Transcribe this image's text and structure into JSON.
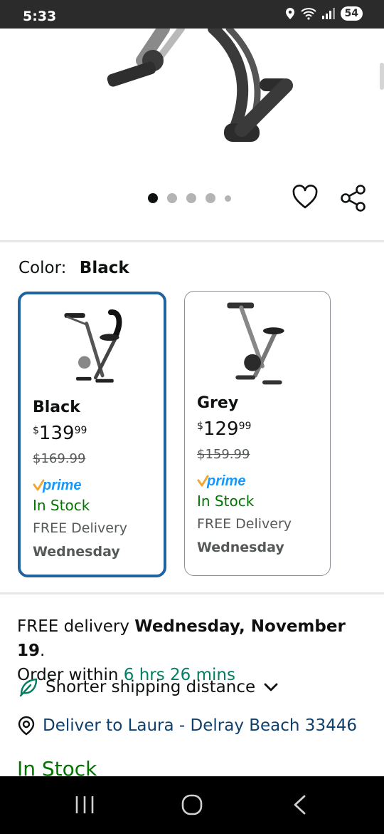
{
  "status_bar": {
    "time": "5:33",
    "battery": "54"
  },
  "gallery": {
    "dot_count": 5,
    "active_index": 0
  },
  "color_selector": {
    "label": "Color:",
    "selected": "Black",
    "options": [
      {
        "name": "Black",
        "price_symbol": "$",
        "price_whole": "139",
        "price_fraction": "99",
        "list_price": "$169.99",
        "badge": "prime",
        "availability": "In Stock",
        "delivery": "FREE Delivery",
        "delivery_day": "Wednesday",
        "selected": true
      },
      {
        "name": "Grey",
        "price_symbol": "$",
        "price_whole": "129",
        "price_fraction": "99",
        "list_price": "$159.99",
        "badge": "prime",
        "availability": "In Stock",
        "delivery": "FREE Delivery",
        "delivery_day": "Wednesday",
        "selected": false
      }
    ]
  },
  "delivery": {
    "prefix": "FREE delivery ",
    "date": "Wednesday, November 19",
    "suffix": ".",
    "order_within_prefix": "Order within ",
    "countdown": "6 hrs 26 mins"
  },
  "shipping": {
    "label": "Shorter shipping distance"
  },
  "deliver_to": {
    "label": "Deliver to Laura - Delray Beach 33446"
  },
  "stock_peek": "In Stock",
  "colors": {
    "selected_border": "#2162a1",
    "in_stock": "#007600",
    "countdown": "#067d62",
    "prime_blue": "#1399ff",
    "prime_check": "#f0a733"
  }
}
